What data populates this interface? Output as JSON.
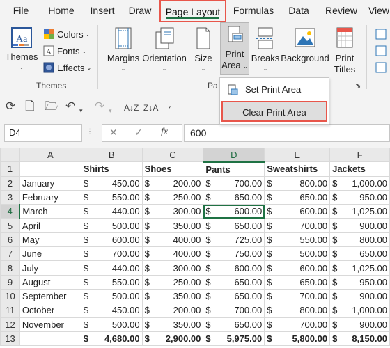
{
  "tabs": [
    "File",
    "Home",
    "Insert",
    "Draw",
    "Page Layout",
    "Formulas",
    "Data",
    "Review",
    "View"
  ],
  "active_tab": "Page Layout",
  "ribbon": {
    "themes_label": "Themes",
    "colors_label": "Colors",
    "fonts_label": "Fonts",
    "effects_label": "Effects",
    "group_themes": "Themes",
    "margins_label": "Margins",
    "orientation_label": "Orientation",
    "size_label": "Size",
    "print_area_line1": "Print",
    "print_area_line2": "Area",
    "breaks_label": "Breaks",
    "background_label": "Background",
    "print_titles_line1": "Print",
    "print_titles_line2": "Titles",
    "group_page_setup_partial": "Pa",
    "chevron": "⌄"
  },
  "menu": {
    "set_print_area": "Set Print Area",
    "clear_print_area": "Clear Print Area"
  },
  "formula_bar": {
    "name_box": "D4",
    "fx": "fx",
    "cancel": "✕",
    "enter": "✓",
    "value": "600"
  },
  "grid": {
    "columns": [
      "A",
      "B",
      "C",
      "D",
      "E",
      "F"
    ],
    "selected_column": "D",
    "selected_row": 4,
    "headers": [
      "",
      "Shirts",
      "Shoes",
      "Pants",
      "Sweatshirts",
      "Jackets"
    ],
    "currency": "$",
    "rows": [
      {
        "n": 2,
        "month": "January",
        "v": [
          "450.00",
          "200.00",
          "700.00",
          "800.00",
          "1,000.00"
        ]
      },
      {
        "n": 3,
        "month": "February",
        "v": [
          "550.00",
          "250.00",
          "650.00",
          "650.00",
          "950.00"
        ]
      },
      {
        "n": 4,
        "month": "March",
        "v": [
          "440.00",
          "300.00",
          "600.00",
          "600.00",
          "1,025.00"
        ]
      },
      {
        "n": 5,
        "month": "April",
        "v": [
          "500.00",
          "350.00",
          "650.00",
          "700.00",
          "900.00"
        ]
      },
      {
        "n": 6,
        "month": "May",
        "v": [
          "600.00",
          "400.00",
          "725.00",
          "550.00",
          "800.00"
        ]
      },
      {
        "n": 7,
        "month": "June",
        "v": [
          "700.00",
          "400.00",
          "750.00",
          "500.00",
          "650.00"
        ]
      },
      {
        "n": 8,
        "month": "July",
        "v": [
          "440.00",
          "300.00",
          "600.00",
          "600.00",
          "1,025.00"
        ]
      },
      {
        "n": 9,
        "month": "August",
        "v": [
          "550.00",
          "250.00",
          "650.00",
          "650.00",
          "950.00"
        ]
      },
      {
        "n": 10,
        "month": "September",
        "v": [
          "500.00",
          "350.00",
          "650.00",
          "700.00",
          "900.00"
        ]
      },
      {
        "n": 11,
        "month": "October",
        "v": [
          "450.00",
          "200.00",
          "700.00",
          "800.00",
          "1,000.00"
        ]
      },
      {
        "n": 12,
        "month": "November",
        "v": [
          "500.00",
          "350.00",
          "650.00",
          "700.00",
          "900.00"
        ]
      }
    ],
    "total_row": {
      "n": 13,
      "v": [
        "4,680.00",
        "2,900.00",
        "5,975.00",
        "5,800.00",
        "8,150.00"
      ]
    }
  }
}
